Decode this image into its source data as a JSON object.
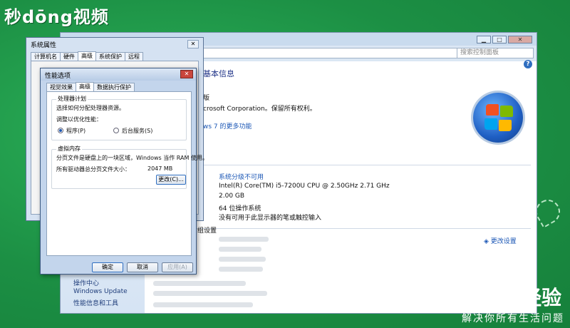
{
  "watermark": {
    "logo": "秒dōng视频",
    "big": "经验",
    "slogan": "解决你所有生活问题"
  },
  "control_panel": {
    "search_placeholder": "搜索控制面板",
    "left_links": [
      "操作中心",
      "Windows Update",
      "性能信息和工具"
    ],
    "header": "基本信息",
    "edition_fragment": "版",
    "copyright_fragment": "crosoft Corporation。保留所有权利。",
    "more_link": "ws 7 的更多功能",
    "rating": "系统分级不可用",
    "processor": "Intel(R) Core(TM) i5-7200U CPU @ 2.50GHz   2.71 GHz",
    "ram": "2.00 GB",
    "system_type": "64 位操作系统",
    "pen_touch": "没有可用于此显示器的笔或触控输入",
    "group_fragment": "组设置",
    "change_settings": "更改设置"
  },
  "system_properties": {
    "title": "系统属性",
    "tabs": [
      "计算机名",
      "硬件",
      "高级",
      "系统保护",
      "远程"
    ],
    "active_tab": 2
  },
  "performance_options": {
    "title": "性能选项",
    "tabs": [
      "视觉效果",
      "高级",
      "数据执行保护"
    ],
    "active_tab": 1,
    "scheduling": {
      "label": "处理器计划",
      "description": "选择如何分配处理器资源。",
      "adjust_label": "调整以优化性能：",
      "option_programs": "程序(P)",
      "option_background": "后台服务(S)",
      "selected": "programs"
    },
    "virtual_memory": {
      "label": "虚拟内存",
      "description": "分页文件是硬盘上的一块区域，Windows 当作 RAM 使用。",
      "total_label": "所有驱动器总分页文件大小：",
      "total_value": "2047 MB",
      "change_button": "更改(C)..."
    },
    "buttons": {
      "ok": "确定",
      "cancel": "取消",
      "apply": "应用(A)"
    }
  }
}
